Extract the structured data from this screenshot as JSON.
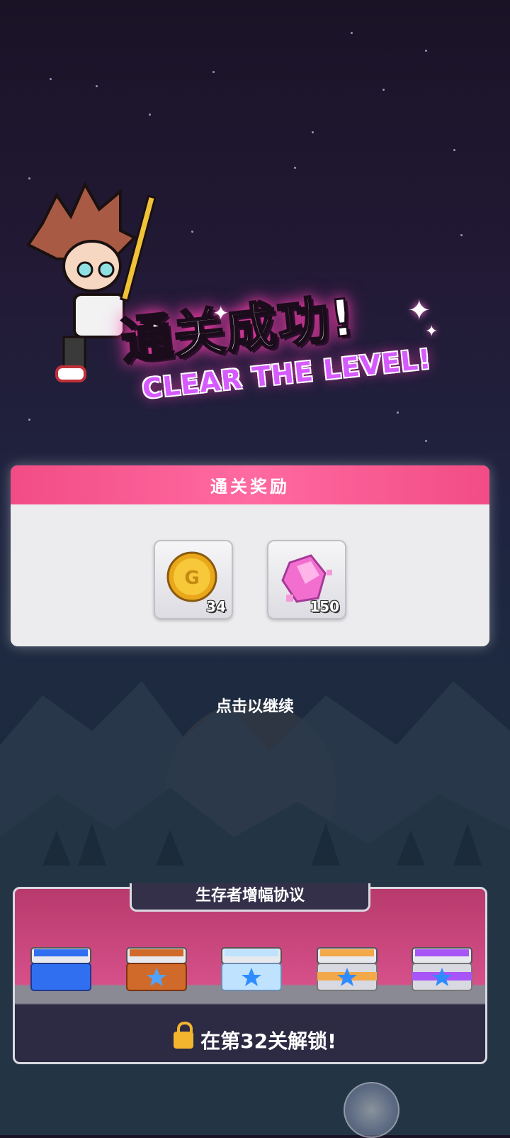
{
  "banner": {
    "title_cn": "通关成功!",
    "title_en": "CLEAR THE LEVEL!"
  },
  "rewards": {
    "header": "通关奖励",
    "items": [
      {
        "icon": "gold-coin-icon",
        "count": "34"
      },
      {
        "icon": "pink-crystal-icon",
        "count": "150"
      }
    ]
  },
  "continue_text": "点击以继续",
  "amplification": {
    "title": "生存者增幅协议",
    "chests": [
      {
        "icon": "blue-chest-icon",
        "color": "#2f6ff0"
      },
      {
        "icon": "orange-chest-icon",
        "color": "#d06a2a"
      },
      {
        "icon": "light-blue-chest-icon",
        "color": "#bfe3ff"
      },
      {
        "icon": "gold-chest-icon",
        "color": "#f3a84a"
      },
      {
        "icon": "purple-chest-icon",
        "color": "#a855f7"
      }
    ],
    "unlock_text": "在第32关解锁!"
  },
  "colors": {
    "accent_pink": "#f24c85",
    "panel": "#ececee"
  }
}
